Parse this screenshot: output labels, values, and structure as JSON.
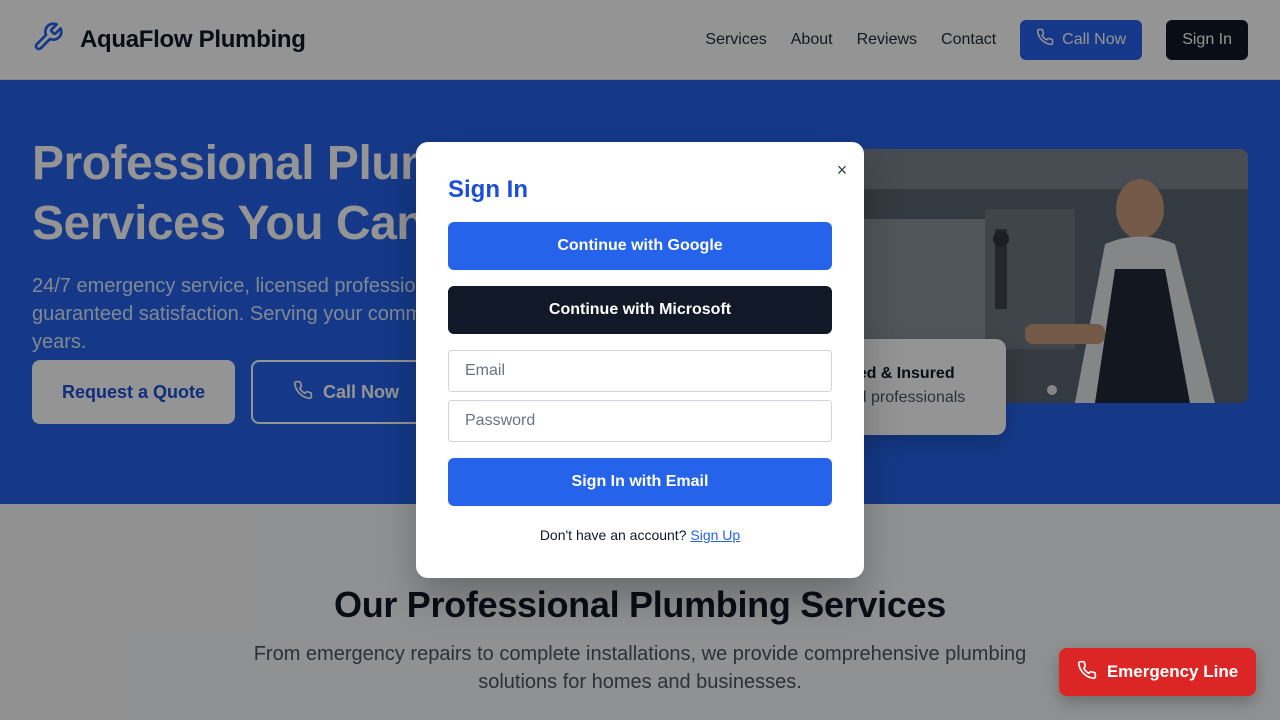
{
  "header": {
    "brand": "AquaFlow Plumbing",
    "nav": [
      "Services",
      "About",
      "Reviews",
      "Contact"
    ],
    "call_label": "Call Now",
    "signin_label": "Sign In"
  },
  "hero": {
    "title": "Professional Plumbing Services You Can Trust",
    "subtitle": "24/7 emergency service, licensed professionals, and guaranteed satisfaction. Serving your community for over 20 years.",
    "quote_label": "Request a Quote",
    "call_label": "Call Now",
    "badge_title": "Licensed & Insured",
    "badge_sub": "Certified professionals",
    "carousel_dots": 2
  },
  "services": {
    "title": "Our Professional Plumbing Services",
    "subtitle": "From emergency repairs to complete installations, we provide comprehensive plumbing solutions for homes and businesses."
  },
  "emergency_label": "Emergency Line",
  "modal": {
    "close_glyph": "×",
    "title": "Sign In",
    "google_label": "Continue with Google",
    "microsoft_label": "Continue with Microsoft",
    "email_placeholder": "Email",
    "password_placeholder": "Password",
    "email_signin_label": "Sign In with Email",
    "signup_prompt": "Don't have an account?",
    "signup_link": "Sign Up"
  },
  "colors": {
    "primary": "#2563eb",
    "dark": "#111827",
    "emergency": "#dc2626"
  },
  "icons": [
    "wrench-icon",
    "phone-icon"
  ]
}
